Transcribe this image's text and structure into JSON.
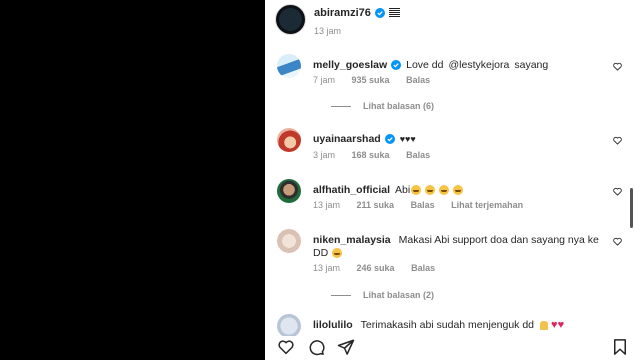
{
  "post": {
    "username": "abiramzi76",
    "time": "13 jam"
  },
  "comments": [
    {
      "username": "melly_goeslaw",
      "verified": true,
      "text_before": "Love dd",
      "mention": "@lestykejora",
      "text_after": "sayang",
      "time": "7 jam",
      "likes": "935 suka",
      "reply": "Balas",
      "view_replies": "Lihat balasan (6)"
    },
    {
      "username": "uyainaarshad",
      "verified": true,
      "text": "♥♥♥",
      "time": "3 jam",
      "likes": "168 suka",
      "reply": "Balas"
    },
    {
      "username": "alfhatih_official",
      "verified": false,
      "text": "Abi",
      "time": "13 jam",
      "likes": "211 suka",
      "reply": "Balas",
      "translate": "Lihat terjemahan"
    },
    {
      "username": "niken_malaysia",
      "verified": false,
      "text": "Makasi Abi support doa dan sayang nya ke",
      "text_line2": "DD",
      "time": "13 jam",
      "likes": "246 suka",
      "reply": "Balas",
      "view_replies": "Lihat balasan (2)"
    },
    {
      "username": "lilolulilo",
      "verified": false,
      "text": "Terimakasih abi sudah menjenguk dd"
    }
  ],
  "icons": [
    "verified-badge-icon",
    "heart-icon",
    "comment-icon",
    "share-icon",
    "bookmark-icon"
  ],
  "colors": {
    "verified": "#0095f6",
    "mention": "#00376b",
    "secondary_text": "#8e8e8e"
  }
}
